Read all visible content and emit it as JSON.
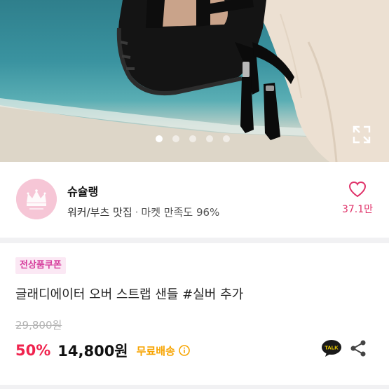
{
  "carousel": {
    "slide_count": 5,
    "active_index": 0
  },
  "seller": {
    "name": "슈슐랭",
    "tag": "워커/부츠 맛집",
    "satisfaction": "마켓 만족도 96%",
    "likes": "37.1만"
  },
  "product": {
    "coupon_label": "전상품쿠폰",
    "title": "글래디에이터 오버 스트랩 샌들 #실버 추가",
    "original_price": "29,800원",
    "discount": "50%",
    "price": "14,800원",
    "shipping": "무료배송"
  },
  "actions": {
    "talk_label": "TALK"
  },
  "colors": {
    "accent_pink": "#e0336a",
    "discount_red": "#f0234e",
    "shipping_orange": "#f7a400",
    "coupon_bg": "#fbe8f4",
    "coupon_text": "#d63d9c"
  },
  "icons": [
    "expand-icon",
    "heart-icon",
    "info-icon",
    "kakao-talk-icon",
    "share-icon",
    "crown-logo-icon"
  ]
}
